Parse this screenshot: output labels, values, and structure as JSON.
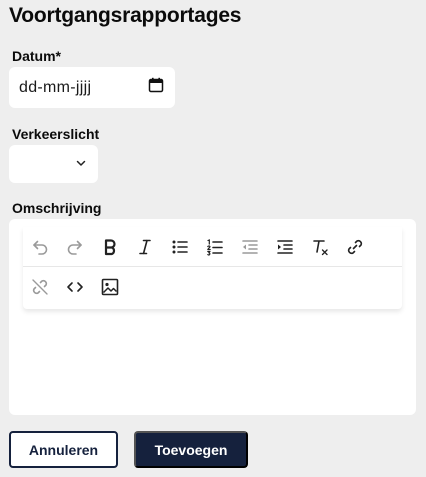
{
  "page": {
    "title": "Voortgangsrapportages"
  },
  "form": {
    "date": {
      "label": "Datum*",
      "placeholder": "dd-mm-jjjj",
      "icon": "calendar-icon"
    },
    "traffic_light": {
      "label": "Verkeerslicht",
      "value": "",
      "icon": "chevron-down-icon"
    },
    "description": {
      "label": "Omschrijving",
      "toolbar_row1": [
        "undo-icon",
        "redo-icon",
        "bold-icon",
        "italic-icon",
        "bullet-list-icon",
        "numbered-list-icon",
        "outdent-icon",
        "indent-icon",
        "clear-formatting-icon",
        "link-icon"
      ],
      "toolbar_row2": [
        "unlink-icon",
        "code-icon",
        "image-icon"
      ],
      "content": ""
    }
  },
  "actions": {
    "cancel_label": "Annuleren",
    "add_label": "Toevoegen"
  },
  "colors": {
    "background": "#eeeeee",
    "primary": "#15213d",
    "surface": "#ffffff",
    "disabled_icon": "#9a9a9a"
  }
}
